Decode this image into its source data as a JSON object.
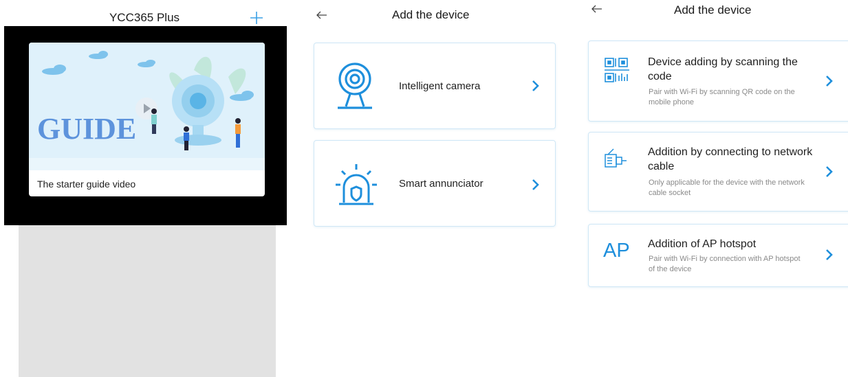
{
  "panel_home": {
    "title": "YCC365 Plus",
    "add_icon": "plus-icon",
    "guide_card": {
      "image_text": "GUIDE",
      "caption": "The starter guide video"
    }
  },
  "panel_add_device": {
    "title": "Add the device",
    "back_icon": "back-arrow-icon",
    "options": [
      {
        "label": "Intelligent camera",
        "icon": "camera-icon"
      },
      {
        "label": "Smart annunciator",
        "icon": "alarm-icon"
      }
    ]
  },
  "panel_add_method": {
    "title": "Add the device",
    "back_icon": "back-arrow-icon",
    "methods": [
      {
        "title": "Device adding by scanning the code",
        "subtitle": "Pair with Wi-Fi by scanning QR code on the mobile phone",
        "icon": "qr-scan-icon"
      },
      {
        "title": "Addition by connecting to network cable",
        "subtitle": "Only applicable for the device with the network cable socket",
        "icon": "network-cable-icon"
      },
      {
        "title": "Addition of AP hotspot",
        "subtitle": "Pair with Wi-Fi by connection with AP hotspot of the device",
        "icon": "ap-hotspot-icon",
        "icon_text": "AP"
      }
    ]
  },
  "colors": {
    "accent": "#1e8fdc",
    "card_border": "#cfe7f6",
    "guide_bg": "#dff1fb",
    "grey_area": "#e2e2e2"
  }
}
